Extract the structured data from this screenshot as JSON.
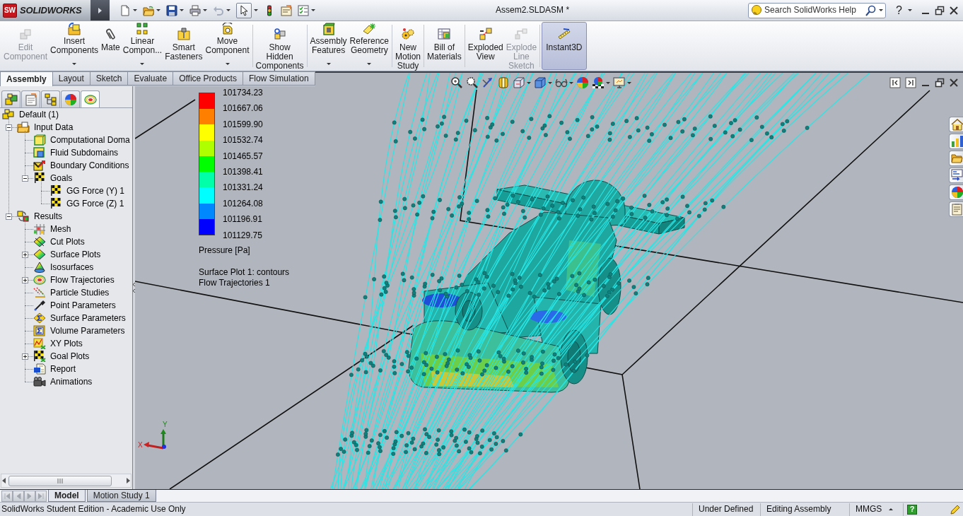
{
  "title_bar": {
    "logo_mark": "SW",
    "app_name": "SOLIDWORKS",
    "quick_access": [
      {
        "kind": "new",
        "dropdown": true,
        "disabled": false,
        "pressed": false
      },
      {
        "kind": "open",
        "dropdown": true,
        "disabled": false,
        "pressed": false
      },
      {
        "kind": "save",
        "dropdown": true,
        "disabled": false,
        "pressed": false
      },
      {
        "kind": "print",
        "dropdown": true,
        "disabled": false,
        "pressed": false
      },
      {
        "kind": "undo",
        "dropdown": true,
        "disabled": true,
        "pressed": false
      },
      {
        "kind": "select",
        "dropdown": true,
        "disabled": false,
        "pressed": true
      },
      {
        "kind": "rebuild",
        "dropdown": false,
        "disabled": false,
        "pressed": false
      },
      {
        "kind": "file-properties",
        "dropdown": false,
        "disabled": false,
        "pressed": false
      },
      {
        "kind": "options",
        "dropdown": true,
        "disabled": false,
        "pressed": false
      }
    ],
    "document_title": "Assem2.SLDASM *",
    "search": {
      "placeholder": "Search SolidWorks Help"
    },
    "help": "?",
    "window_controls": [
      {
        "kind": "minimize"
      },
      {
        "kind": "restore"
      },
      {
        "kind": "close"
      }
    ]
  },
  "ribbon": {
    "groups": [
      [
        {
          "kind": "edit-component",
          "label": "Edit\nComponent",
          "dropdown": false,
          "disabled": true,
          "pressed": false
        },
        {
          "kind": "insert-components",
          "label": "Insert\nComponents",
          "dropdown": true,
          "disabled": false,
          "pressed": false
        },
        {
          "kind": "mate",
          "label": "Mate",
          "dropdown": false,
          "disabled": false,
          "pressed": false
        },
        {
          "kind": "linear-pattern",
          "label": "Linear\nCompon...",
          "dropdown": true,
          "disabled": false,
          "pressed": false
        },
        {
          "kind": "smart-fasteners",
          "label": "Smart\nFasteners",
          "dropdown": false,
          "disabled": false,
          "pressed": false
        },
        {
          "kind": "move-component",
          "label": "Move\nComponent",
          "dropdown": true,
          "disabled": false,
          "pressed": false
        }
      ],
      [
        {
          "kind": "show-hidden-components",
          "label": "Show\nHidden\nComponents",
          "dropdown": false,
          "disabled": false,
          "pressed": false
        }
      ],
      [
        {
          "kind": "assembly-features",
          "label": "Assembly\nFeatures",
          "dropdown": true,
          "disabled": false,
          "pressed": false
        },
        {
          "kind": "reference-geometry",
          "label": "Reference\nGeometry",
          "dropdown": true,
          "disabled": false,
          "pressed": false
        }
      ],
      [
        {
          "kind": "new-motion-study",
          "label": "New\nMotion\nStudy",
          "dropdown": false,
          "disabled": false,
          "pressed": false
        }
      ],
      [
        {
          "kind": "bill-of-materials",
          "label": "Bill of\nMaterials",
          "dropdown": false,
          "disabled": false,
          "pressed": false
        }
      ],
      [
        {
          "kind": "exploded-view",
          "label": "Exploded\nView",
          "dropdown": false,
          "disabled": false,
          "pressed": false
        },
        {
          "kind": "explode-line-sketch",
          "label": "Explode\nLine\nSketch",
          "dropdown": false,
          "disabled": true,
          "pressed": false
        }
      ],
      [
        {
          "kind": "instant3d",
          "label": "Instant3D",
          "dropdown": false,
          "disabled": false,
          "pressed": true
        }
      ]
    ]
  },
  "tabs": [
    {
      "label": "Assembly",
      "selected": true
    },
    {
      "label": "Layout",
      "selected": false
    },
    {
      "label": "Sketch",
      "selected": false
    },
    {
      "label": "Evaluate",
      "selected": false
    },
    {
      "label": "Office Products",
      "selected": false
    },
    {
      "label": "Flow Simulation",
      "selected": false
    }
  ],
  "panel_tabs": [
    {
      "kind": "feature-manager",
      "selected": false
    },
    {
      "kind": "property-manager",
      "selected": false
    },
    {
      "kind": "configuration-manager",
      "selected": false
    },
    {
      "kind": "display-manager",
      "selected": false
    },
    {
      "kind": "flow-simulation",
      "selected": true
    }
  ],
  "feature_tree": {
    "label": "Default (1)",
    "kind": "project",
    "children": [
      {
        "label": "Input Data",
        "kind": "input-data",
        "expanded": true,
        "children": [
          {
            "label": "Computational Doma",
            "kind": "computational-domain"
          },
          {
            "label": "Fluid Subdomains",
            "kind": "fluid-subdomains"
          },
          {
            "label": "Boundary Conditions",
            "kind": "boundary-conditions"
          },
          {
            "label": "Goals",
            "kind": "goals",
            "expanded": true,
            "children": [
              {
                "label": "GG Force (Y) 1",
                "kind": "goal"
              },
              {
                "label": "GG Force (Z) 1",
                "kind": "goal"
              }
            ]
          }
        ]
      },
      {
        "label": "Results",
        "kind": "results",
        "expanded": true,
        "children": [
          {
            "label": "Mesh",
            "kind": "mesh"
          },
          {
            "label": "Cut Plots",
            "kind": "cut-plots"
          },
          {
            "label": "Surface Plots",
            "kind": "surface-plots",
            "expanded": false
          },
          {
            "label": "Isosurfaces",
            "kind": "isosurfaces"
          },
          {
            "label": "Flow Trajectories",
            "kind": "flow-trajectories",
            "expanded": false
          },
          {
            "label": "Particle Studies",
            "kind": "particle-studies"
          },
          {
            "label": "Point Parameters",
            "kind": "point-parameters"
          },
          {
            "label": "Surface Parameters",
            "kind": "surface-parameters"
          },
          {
            "label": "Volume Parameters",
            "kind": "volume-parameters"
          },
          {
            "label": "XY Plots",
            "kind": "xy-plots"
          },
          {
            "label": "Goal Plots",
            "kind": "goal-plots",
            "expanded": false
          },
          {
            "label": "Report",
            "kind": "report"
          },
          {
            "label": "Animations",
            "kind": "animations"
          }
        ]
      }
    ]
  },
  "graphics_area": {
    "view_toolbar": [
      {
        "kind": "zoom-to-fit",
        "dropdown": false
      },
      {
        "kind": "zoom-to-area",
        "dropdown": false
      },
      {
        "kind": "previous-view",
        "dropdown": false
      },
      {
        "kind": "section-view",
        "dropdown": false
      },
      {
        "kind": "view-orientation",
        "dropdown": true
      },
      {
        "kind": "display-style",
        "dropdown": true
      },
      {
        "kind": "hide-show-items",
        "dropdown": true
      },
      {
        "kind": "edit-appearance",
        "dropdown": false
      },
      {
        "kind": "apply-scene",
        "dropdown": true
      },
      {
        "kind": "view-settings",
        "dropdown": true
      }
    ],
    "window_controls": [
      {
        "kind": "tile-left"
      },
      {
        "kind": "tile-right"
      },
      {
        "kind": "minimize"
      },
      {
        "kind": "restore"
      },
      {
        "kind": "close"
      }
    ],
    "task_pane": [
      {
        "kind": "home"
      },
      {
        "kind": "design-library"
      },
      {
        "kind": "file-explorer"
      },
      {
        "kind": "view-palette"
      },
      {
        "kind": "appearances"
      },
      {
        "kind": "custom-properties"
      }
    ],
    "legend": {
      "values": [
        "101734.23",
        "101667.06",
        "101599.90",
        "101532.74",
        "101465.57",
        "101398.41",
        "101331.24",
        "101264.08",
        "101196.91",
        "101129.75"
      ],
      "bands": [
        {
          "color": "#ff0000"
        },
        {
          "color": "#ff8000"
        },
        {
          "color": "#ffff00"
        },
        {
          "color": "#b0ff00"
        },
        {
          "color": "#00ff00"
        },
        {
          "color": "#00ffa8"
        },
        {
          "color": "#00ffff"
        },
        {
          "color": "#0088ff"
        },
        {
          "color": "#0000ff"
        }
      ],
      "quantity": "Pressure [Pa]",
      "plots": [
        "Surface Plot 1: contours",
        "Flow Trajectories 1"
      ]
    },
    "triad": {
      "x": "X",
      "y": "Y"
    }
  },
  "sheet_tabs": {
    "nav": [
      {
        "kind": "first",
        "disabled": true
      },
      {
        "kind": "previous",
        "disabled": true
      },
      {
        "kind": "next",
        "disabled": true
      },
      {
        "kind": "last",
        "disabled": true
      }
    ],
    "tabs": [
      {
        "label": "Model",
        "selected": true
      },
      {
        "label": "Motion Study 1",
        "selected": false
      }
    ]
  },
  "status_bar": {
    "message": "SolidWorks Student Edition - Academic Use Only",
    "fields": [
      "Under Defined",
      "Editing Assembly"
    ],
    "units": "MMGS",
    "help": "?"
  }
}
